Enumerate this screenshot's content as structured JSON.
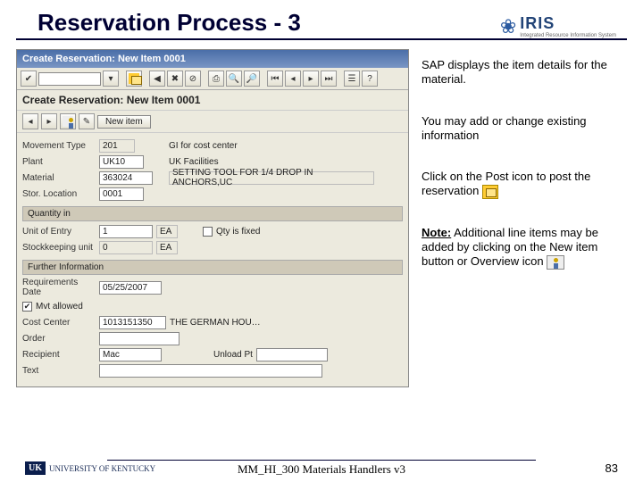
{
  "title": "Reservation Process - 3",
  "logo": {
    "brand": "IRIS",
    "sub": "Integrated Resource Information System"
  },
  "sap": {
    "winTitle1": "Create Reservation: New Item 0001",
    "winTitle2": "Create Reservation: New Item 0001",
    "newItemBtn": "New item",
    "fields": {
      "movementType_lbl": "Movement Type",
      "movementType_val": "201",
      "movementDesc": "GI for cost center",
      "plant_lbl": "Plant",
      "plant_val": "UK10",
      "plant_desc": "UK Facilities",
      "material_lbl": "Material",
      "material_val": "363024",
      "material_desc": "SETTING TOOL FOR 1/4 DROP IN ANCHORS,UC",
      "storloc_lbl": "Stor. Location",
      "storloc_val": "0001",
      "sec_qty": "Quantity in",
      "uoe_lbl": "Unit of Entry",
      "uoe_qty": "1",
      "uoe_unit": "EA",
      "qtyfixed_lbl": "Qty is fixed",
      "sku_lbl": "Stockkeeping unit",
      "sku_qty": "0",
      "sku_unit": "EA",
      "sec_further": "Further Information",
      "reqdate_lbl": "Requirements Date",
      "reqdate_val": "05/25/2007",
      "mvtallowed_lbl": "Mvt allowed",
      "cc_lbl": "Cost Center",
      "cc_val": "1013151350",
      "cc_desc": "THE GERMAN HOU…",
      "order_lbl": "Order",
      "recipient_lbl": "Recipient",
      "recipient_val": "Mac",
      "unload_lbl": "Unload Pt",
      "text_lbl": "Text"
    }
  },
  "right": {
    "p1": "SAP displays the item details for the material.",
    "p2": "You may add or change existing information",
    "p3": "Click on the Post icon to post the reservation",
    "noteLabel": "Note:",
    "noteText": " Additional line items may be added by clicking on the New item button or Overview icon"
  },
  "footer": {
    "uk": "UNIVERSITY OF KENTUCKY",
    "center": "MM_HI_300 Materials Handlers v3",
    "page": "83"
  }
}
